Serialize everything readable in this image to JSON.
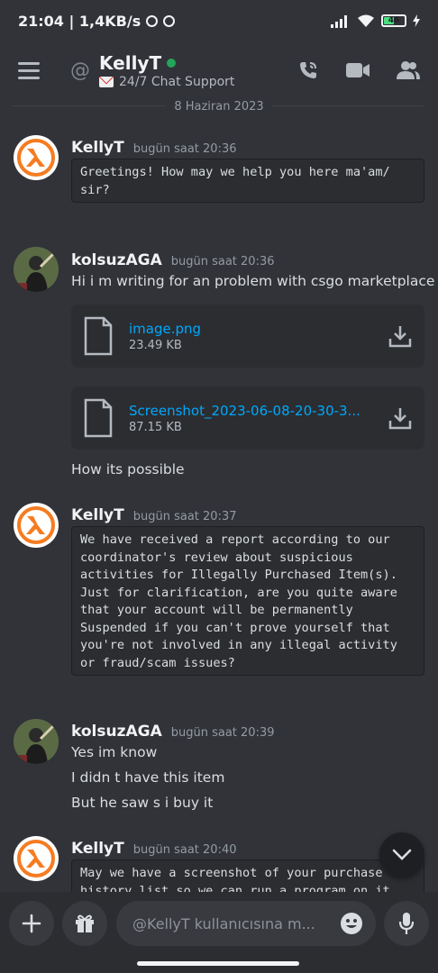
{
  "status_bar": {
    "time_speed": "21:04 | 1,4KB/s",
    "battery": "46"
  },
  "header": {
    "title": "KellyT",
    "subtitle": "24/7 Chat Support"
  },
  "date_divider": "8 Haziran 2023",
  "messages": [
    {
      "author": "KellyT",
      "timestamp": "bugün saat 20:36",
      "code": "Greetings! How may we help you here ma'am/\nsir?"
    },
    {
      "author": "kolsuzAGA",
      "timestamp": "bugün saat 20:36",
      "text": "Hi i m writing for an problem with csgo marketplace",
      "attachments": [
        {
          "name": "image.png",
          "size": "23.49 KB"
        },
        {
          "name": "Screenshot_2023-06-08-20-30-3...",
          "size": "87.15 KB"
        }
      ],
      "text2": "How its possible"
    },
    {
      "author": "KellyT",
      "timestamp": "bugün saat 20:37",
      "code": "We have received a report according to our\ncoordinator's review about suspicious\nactivities for Illegally Purchased Item(s).\nJust for clarification, are you quite aware\nthat your account will be permanently\nSuspended if you can't prove yourself that\nyou're not involved in any illegal activity\nor fraud/scam issues?"
    },
    {
      "author": "kolsuzAGA",
      "timestamp": "bugün saat 20:39",
      "lines": [
        "Yes im know",
        "I didn t have this item",
        "But he saw s i buy it"
      ]
    },
    {
      "author": "KellyT",
      "timestamp": "bugün saat 20:40",
      "code": "May we have a screenshot of your purchase\nhistory list so we can run a program on it"
    }
  ],
  "composer": {
    "placeholder": "@KellyT kullanıcısına m..."
  },
  "colors": {
    "background": "#313338",
    "link": "#00a8fc",
    "online": "#23a55a",
    "code_bg": "#2b2d31"
  },
  "icons": [
    "menu-icon",
    "at-icon",
    "call-icon",
    "video-icon",
    "members-icon",
    "file-icon",
    "download-icon",
    "chevron-down-icon",
    "plus-icon",
    "gift-icon",
    "emoji-icon",
    "mic-icon"
  ]
}
